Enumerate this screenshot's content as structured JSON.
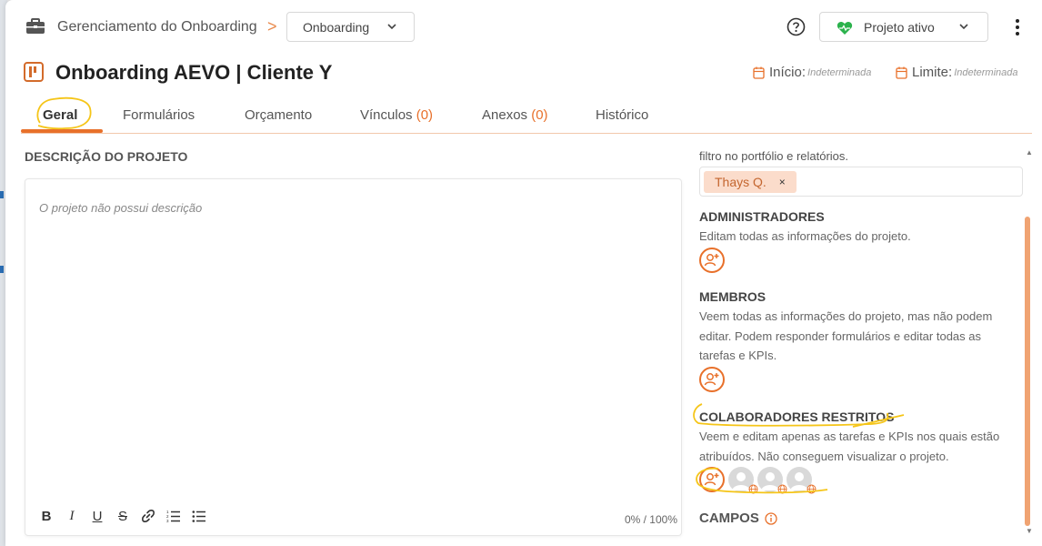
{
  "header": {
    "breadcrumb": "Gerenciamento do Onboarding",
    "breadcrumb_sep": ">",
    "board_select": "Onboarding",
    "status_select": "Projeto ativo"
  },
  "project": {
    "title": "Onboarding AEVO | Cliente Y",
    "start_label": "Início:",
    "start_value": "Indeterminada",
    "limit_label": "Limite:",
    "limit_value": "Indeterminada"
  },
  "tabs": [
    {
      "label": "Geral",
      "count": ""
    },
    {
      "label": "Formulários",
      "count": ""
    },
    {
      "label": "Orçamento",
      "count": ""
    },
    {
      "label": "Vínculos",
      "count": "(0)"
    },
    {
      "label": "Anexos",
      "count": "(0)"
    },
    {
      "label": "Histórico",
      "count": ""
    }
  ],
  "description": {
    "title": "DESCRIÇÃO DO PROJETO",
    "placeholder": "O projeto não possui descrição",
    "counter": "0% / 100%",
    "toolbar": [
      "B",
      "I",
      "U",
      "S",
      "link",
      "ordered-list",
      "bullet-list"
    ]
  },
  "sidebar": {
    "intro": "filtro no portfólio e relatórios.",
    "chip": "Thays Q.",
    "chip_remove": "×",
    "admins": {
      "title": "ADMINISTRADORES",
      "desc": "Editam todas as informações do projeto."
    },
    "members": {
      "title": "MEMBROS",
      "desc": "Veem todas as informações do projeto, mas não podem editar. Podem responder formulários e editar todas as tarefas e KPIs."
    },
    "restricted": {
      "title": "COLABORADORES RESTRITOS",
      "desc": "Veem e editam apenas as tarefas e KPIs nos quais estão atribuídos. Não conseguem visualizar o projeto."
    },
    "campos": "CAMPOS"
  },
  "colors": {
    "accent": "#e8702a",
    "status_green": "#2bb24c",
    "highlight": "#f5c518"
  }
}
